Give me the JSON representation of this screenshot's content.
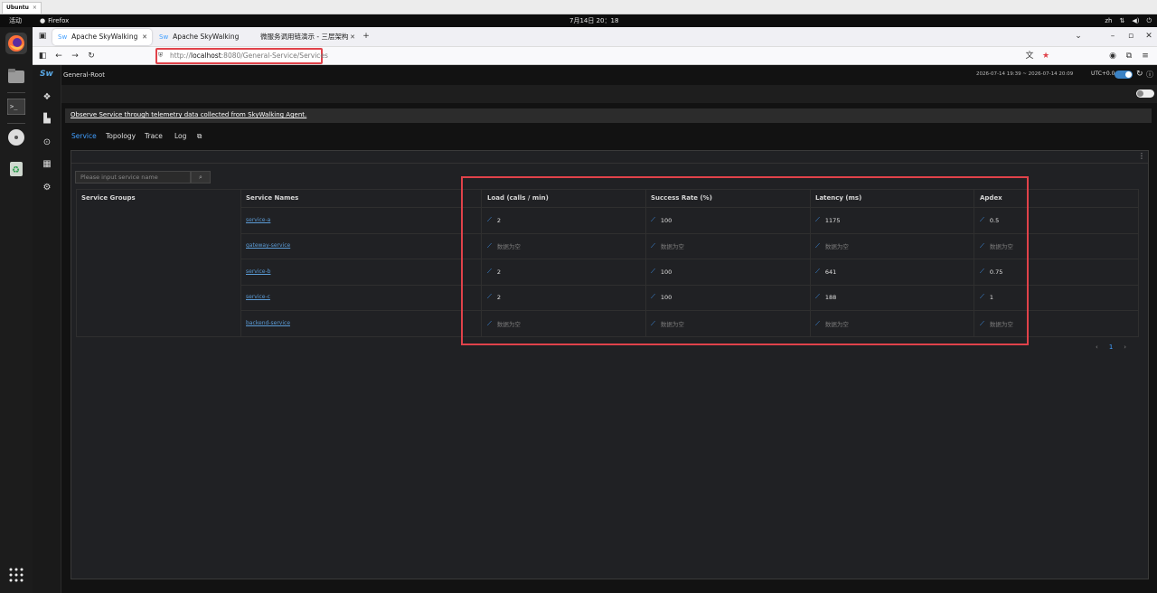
{
  "vm": {
    "tab_label": "Ubuntu",
    "tab_close": "×"
  },
  "topbar": {
    "activities": "活动",
    "app_name": "Firefox",
    "clock": "7月14日 20：18",
    "lang": "zh"
  },
  "browser": {
    "tabs": [
      {
        "label": "Apache SkyWalking",
        "active": true
      },
      {
        "label": "Apache SkyWalking",
        "active": false
      },
      {
        "label": "微服务调用链演示 - 三层架构",
        "active": false
      }
    ],
    "new_tab": "+",
    "url_scheme": "http://",
    "url_host": "localhost",
    "url_rest": ":8080/General-Service/Services"
  },
  "app": {
    "logo": "Sw",
    "page_title": "General-Root",
    "time_range": "2026-07-14 19:39 ~ 2026-07-14 20:09",
    "utc": "UTC+0.0",
    "description": "Observe Service through telemetry data collected from SkyWalking Agent.",
    "tabs": [
      "Service",
      "Topology",
      "Trace",
      "Log"
    ],
    "search_placeholder": "Please input service name",
    "table": {
      "headers": [
        "Service Groups",
        "Service Names",
        "Load (calls / min)",
        "Success Rate (%)",
        "Latency (ms)",
        "Apdex"
      ],
      "rows": [
        {
          "name": "service-a",
          "load": "2",
          "success": "100",
          "latency": "1175",
          "apdex": "0.5"
        },
        {
          "name": "gateway-service",
          "load": "数据为空",
          "success": "数据为空",
          "latency": "数据为空",
          "apdex": "数据为空"
        },
        {
          "name": "service-b",
          "load": "2",
          "success": "100",
          "latency": "641",
          "apdex": "0.75"
        },
        {
          "name": "service-c",
          "load": "2",
          "success": "100",
          "latency": "188",
          "apdex": "1"
        },
        {
          "name": "backend-service",
          "load": "数据为空",
          "success": "数据为空",
          "latency": "数据为空",
          "apdex": "数据为空"
        }
      ]
    },
    "pager": {
      "prev": "‹",
      "page": "1",
      "next": "›"
    }
  },
  "colors": {
    "accent": "#409eff",
    "highlight": "#e0424a",
    "background": "#121212"
  }
}
